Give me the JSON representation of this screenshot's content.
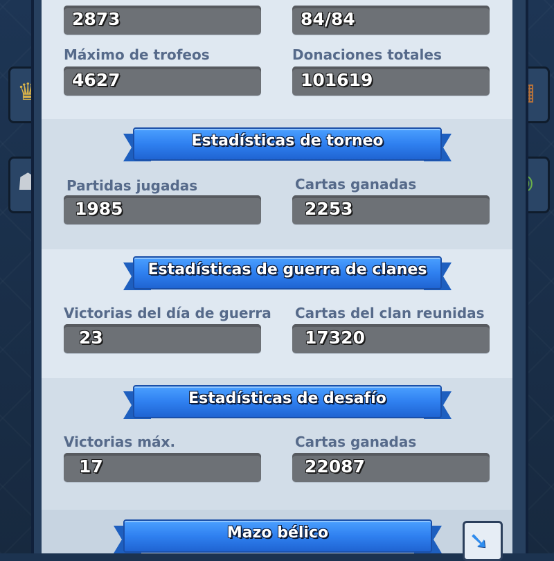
{
  "top_stats": {
    "left_value": "2873",
    "right_value": "84/84"
  },
  "general": {
    "max_trophies_label": "Máximo de trofeos",
    "max_trophies_value": "4627",
    "total_donations_label": "Donaciones totales",
    "total_donations_value": "101619"
  },
  "tournament": {
    "title": "Estadísticas de torneo",
    "games_played_label": "Partidas jugadas",
    "games_played_value": "1985",
    "cards_won_label": "Cartas ganadas",
    "cards_won_value": "2253"
  },
  "clan_war": {
    "title": "Estadísticas de guerra de clanes",
    "war_day_wins_label": "Victorias del día de guerra",
    "war_day_wins_value": "23",
    "clan_cards_label": "Cartas del clan reunidas",
    "clan_cards_value": "17320"
  },
  "challenge": {
    "title": "Estadísticas de desafío",
    "max_wins_label": "Victorias máx.",
    "max_wins_value": "17",
    "cards_won_label": "Cartas ganadas",
    "cards_won_value": "22087"
  },
  "war_deck": {
    "title": "Mazo bélico",
    "share_icon": "share-arrow-icon"
  },
  "colors": {
    "banner_blue": "#2f80f0",
    "field_gray": "#6d7176",
    "label_blue_gray": "#566a8a"
  }
}
